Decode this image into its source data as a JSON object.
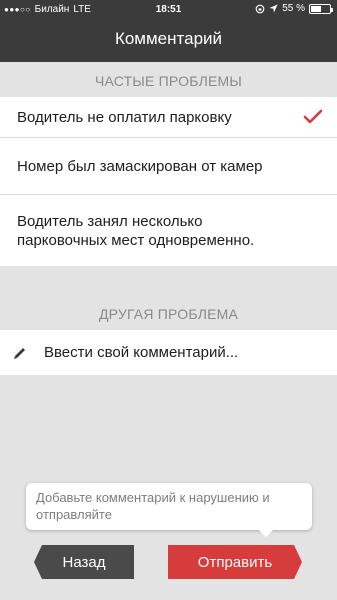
{
  "status_bar": {
    "carrier": "Билайн",
    "network": "LTE",
    "time": "18:51",
    "battery_percent": "55 %",
    "battery_level": 0.55
  },
  "header": {
    "title": "Комментарий"
  },
  "frequent": {
    "heading": "ЧАСТЫЕ ПРОБЛЕМЫ",
    "items": [
      {
        "label": "Водитель не оплатил парковку",
        "selected": true
      },
      {
        "label": "Номер был замаскирован от камер",
        "selected": false
      },
      {
        "label": "Водитель занял несколько парковочных мест одновременно.",
        "selected": false
      }
    ]
  },
  "other": {
    "heading": "ДРУГАЯ ПРОБЛЕМА",
    "comment_placeholder": "Ввести свой комментарий..."
  },
  "tooltip": {
    "text": "Добавьте комментарий к нарушению и отправляйте"
  },
  "buttons": {
    "back_label": "Назад",
    "send_label": "Отправить"
  },
  "colors": {
    "header_bg": "#3b3b3b",
    "accent_red": "#d63c3c",
    "back_bg": "#4a4a4a",
    "page_bg": "#e3e3e3"
  }
}
